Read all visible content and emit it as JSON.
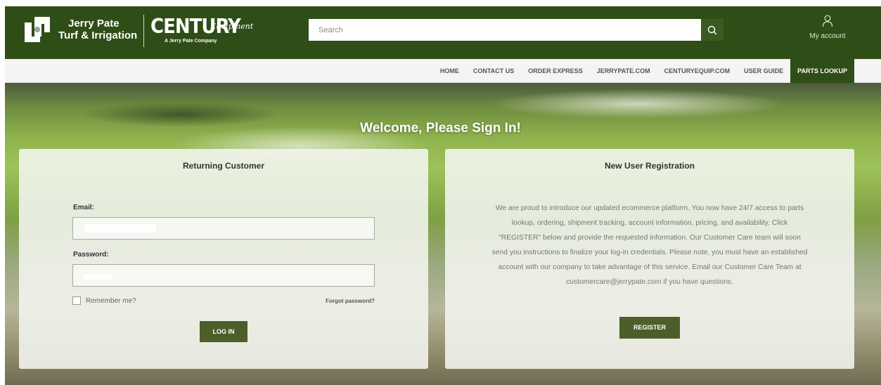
{
  "header": {
    "brand_line1": "Jerry Pate",
    "brand_line2": "Turf & Irrigation",
    "century_word": "CENTURY",
    "century_script": "Equipment",
    "century_sub": "A Jerry Pate Company",
    "search_placeholder": "Search",
    "account_label": "My account"
  },
  "nav": {
    "items": [
      "HOME",
      "CONTACT US",
      "ORDER EXPRESS",
      "JERRYPATE.COM",
      "CENTURYEQUIP.COM",
      "USER GUIDE",
      "PARTS LOOKUP"
    ],
    "active": "PARTS LOOKUP"
  },
  "hero": {
    "welcome": "Welcome, Please Sign In!"
  },
  "login": {
    "title": "Returning Customer",
    "email_label": "Email:",
    "password_label": "Password:",
    "remember_label": "Remember me?",
    "forgot_label": "Forgot password?",
    "login_button": "LOG IN"
  },
  "register": {
    "title": "New User Registration",
    "body": "We are proud to introduce our updated ecommerce platform. You now have 24/7 access to parts lookup, ordering, shipment tracking, account information, pricing, and availability. Click \"REGISTER\" below and provide the requested information. Our Customer Care team will soon send you instructions to finalize your log-in credentials. Please note, you must have an established account with our company to take advantage of this service. Email our Customer Care Team at customercare@jerrypate.com if you have questions.",
    "register_button": "REGISTER"
  },
  "colors": {
    "brand_green": "#2f4d16",
    "button_green": "#4c5e2a"
  }
}
